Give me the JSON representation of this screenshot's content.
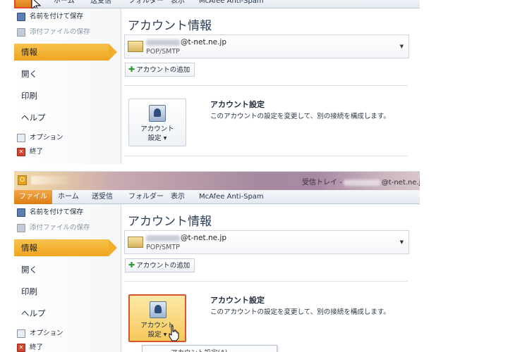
{
  "ribbon": {
    "tabs": [
      "ファイル",
      "ホーム",
      "送受信",
      "フォルダー",
      "表示",
      "McAfee Anti-Spam"
    ]
  },
  "window": {
    "title_prefix": "受信トレイ -",
    "title_suffix": "@t-net.ne.jp -"
  },
  "nav": {
    "save_as": "名前を付けて保存",
    "save_attachments": "添付ファイルの保存",
    "info": "情報",
    "open": "開く",
    "print": "印刷",
    "help": "ヘルプ",
    "options": "オプション",
    "exit": "終了"
  },
  "content": {
    "heading": "アカウント情報",
    "account_address": "@t-net.ne.jp",
    "account_type": "POP/SMTP",
    "add_account_label": "アカウントの追加",
    "settings_button_line1": "アカウント",
    "settings_button_line2": "設定 ▾",
    "settings_title": "アカウント設定",
    "settings_description": "このアカウントの設定を変更して、別の接続を構成します。",
    "dropdown_item": "アカウント設定(A)..."
  },
  "colors": {
    "accent": "#f0a521",
    "file_tab": "#dc7d12",
    "highlight_border": "#d9562b"
  }
}
